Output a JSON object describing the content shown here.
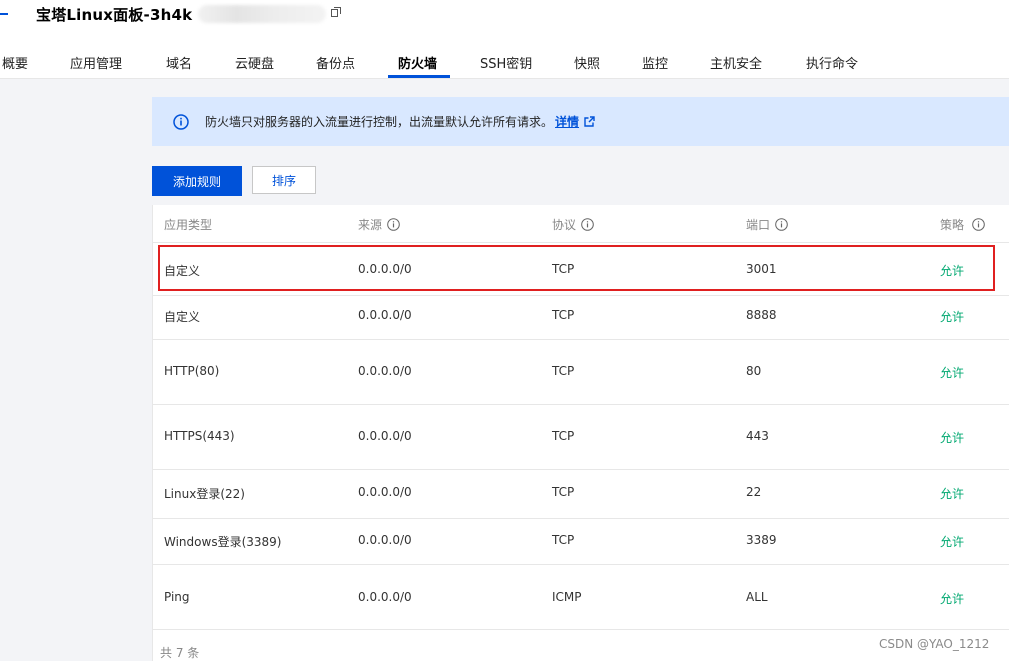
{
  "header": {
    "title": "宝塔Linux面板-3h4k"
  },
  "tabs": [
    {
      "label": "概要"
    },
    {
      "label": "应用管理"
    },
    {
      "label": "域名"
    },
    {
      "label": "云硬盘"
    },
    {
      "label": "备份点"
    },
    {
      "label": "防火墙",
      "active": true
    },
    {
      "label": "SSH密钥"
    },
    {
      "label": "快照"
    },
    {
      "label": "监控"
    },
    {
      "label": "主机安全"
    },
    {
      "label": "执行命令"
    }
  ],
  "notice": {
    "text": "防火墙只对服务器的入流量进行控制，出流量默认允许所有请求。",
    "link": "详情",
    "icon": "info-icon"
  },
  "toolbar": {
    "add_rule": "添加规则",
    "sort": "排序"
  },
  "table": {
    "columns": [
      "应用类型",
      "来源",
      "协议",
      "端口",
      "策略"
    ],
    "rows": [
      {
        "type": "自定义",
        "source": "0.0.0.0/0",
        "protocol": "TCP",
        "port": "3001",
        "policy": "允许"
      },
      {
        "type": "自定义",
        "source": "0.0.0.0/0",
        "protocol": "TCP",
        "port": "8888",
        "policy": "允许"
      },
      {
        "type": "HTTP(80)",
        "source": "0.0.0.0/0",
        "protocol": "TCP",
        "port": "80",
        "policy": "允许"
      },
      {
        "type": "HTTPS(443)",
        "source": "0.0.0.0/0",
        "protocol": "TCP",
        "port": "443",
        "policy": "允许"
      },
      {
        "type": "Linux登录(22)",
        "source": "0.0.0.0/0",
        "protocol": "TCP",
        "port": "22",
        "policy": "允许"
      },
      {
        "type": "Windows登录(3389)",
        "source": "0.0.0.0/0",
        "protocol": "TCP",
        "port": "3389",
        "policy": "允许"
      },
      {
        "type": "Ping",
        "source": "0.0.0.0/0",
        "protocol": "ICMP",
        "port": "ALL",
        "policy": "允许"
      }
    ],
    "total": "共 7 条"
  },
  "watermark": "CSDN @YAO_1212",
  "colors": {
    "accent": "#0052d9",
    "allow": "#00a870",
    "highlight": "#e02020",
    "notice_bg": "#d9e8ff"
  }
}
